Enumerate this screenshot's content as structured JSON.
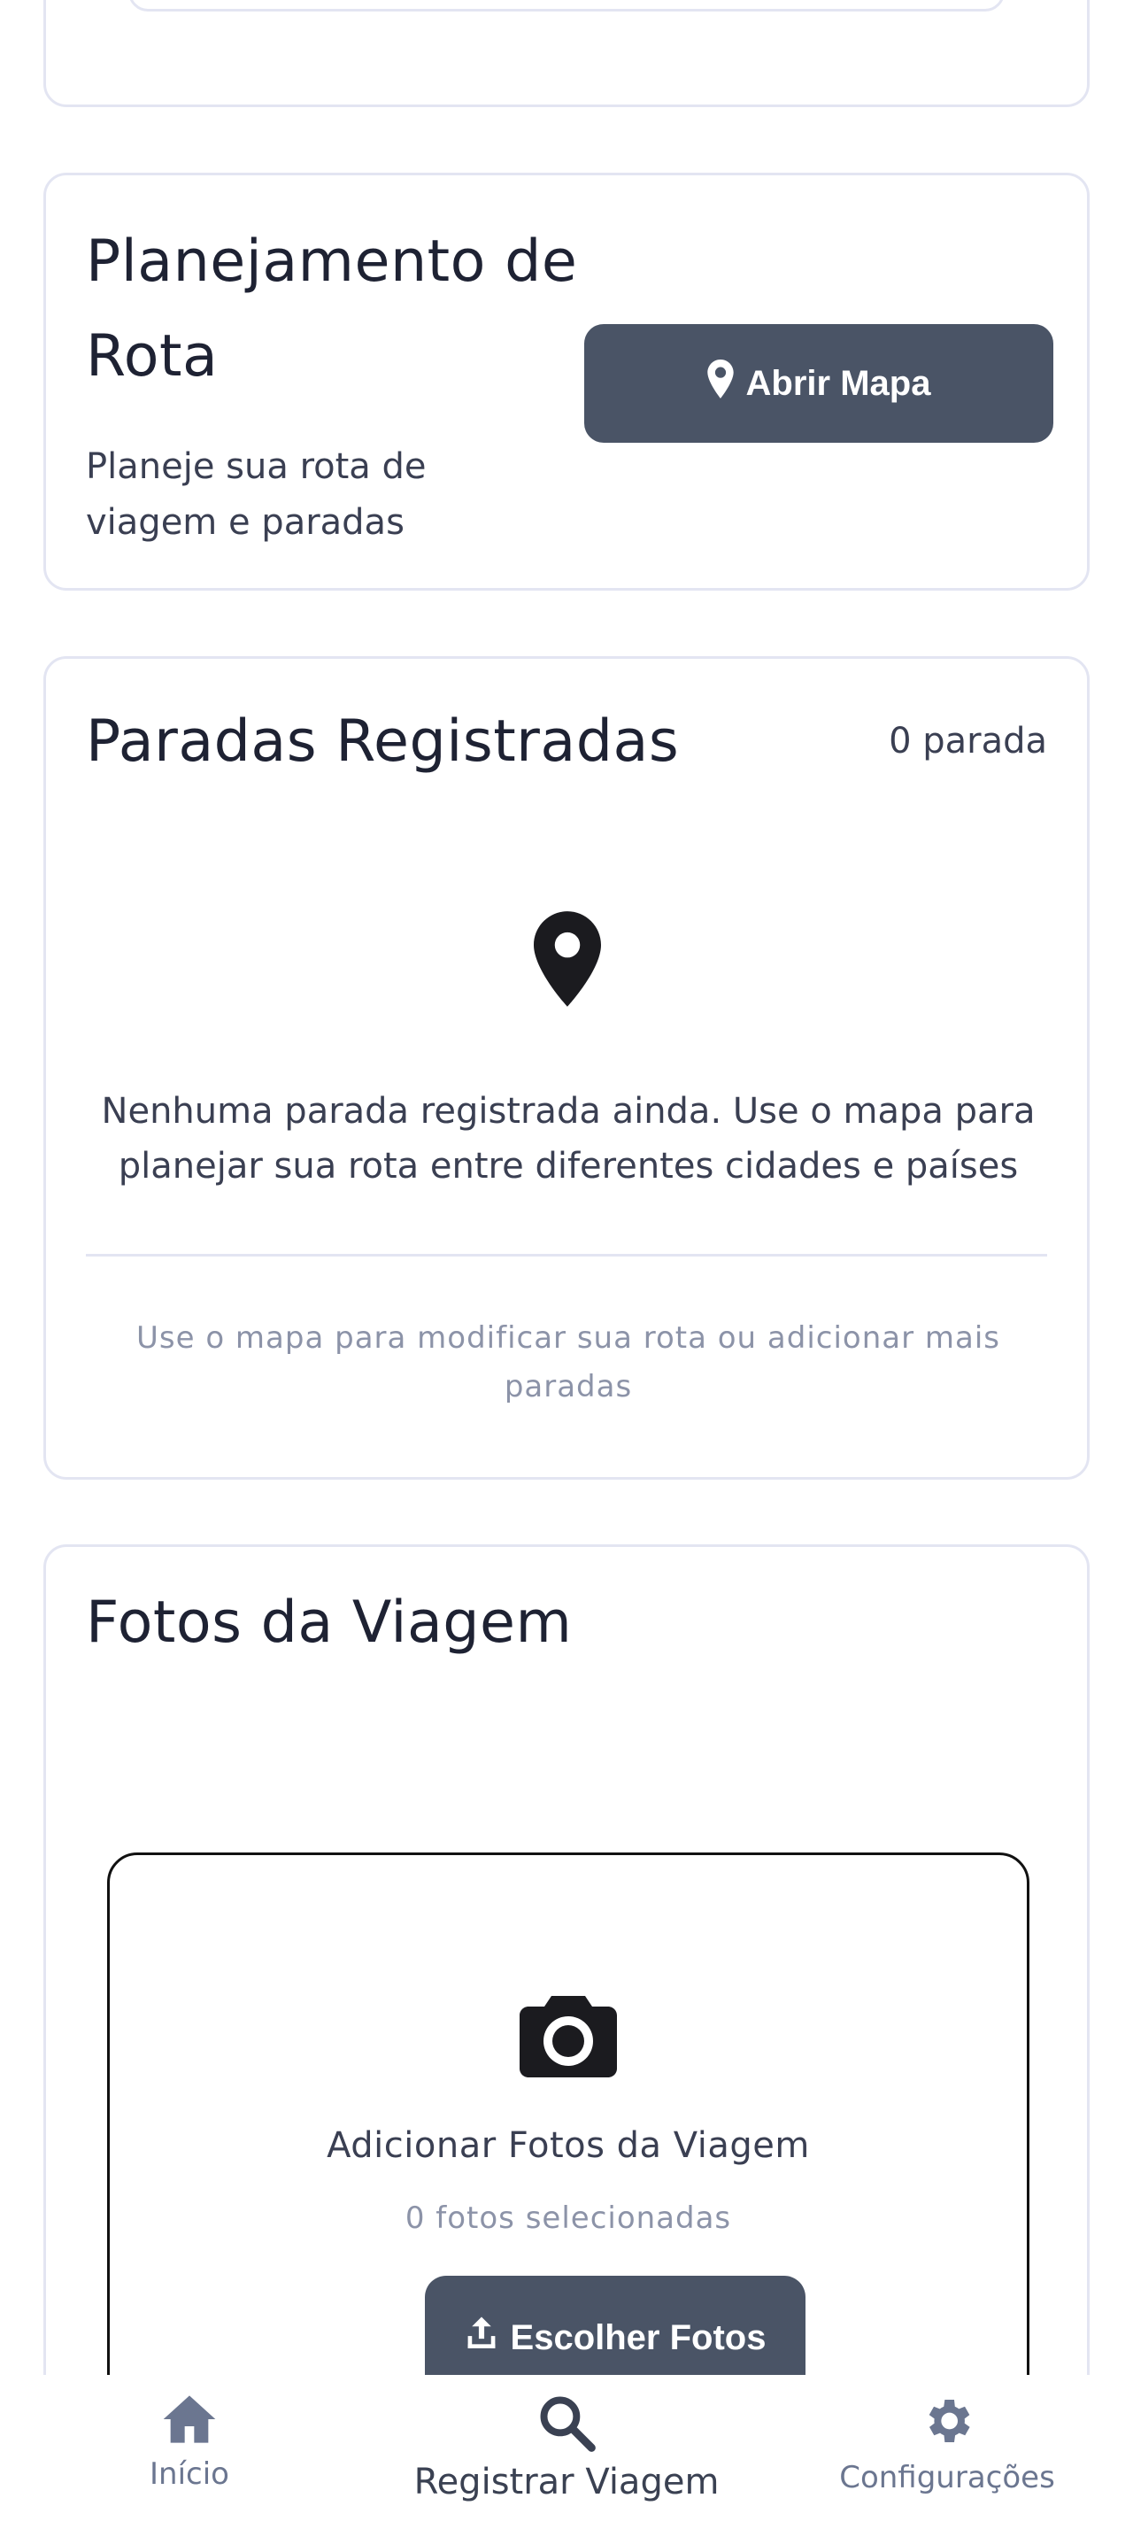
{
  "route_card": {
    "title": "Planejamento de Rota",
    "description": "Planeje sua rota de viagem e paradas",
    "map_button": "Abrir Mapa"
  },
  "stops_card": {
    "title": "Paradas Registradas",
    "count": "0 parada",
    "empty_message": "Nenhuma parada registrada ainda. Use o mapa para planejar sua rota entre diferentes cidades e países",
    "hint": "Use o mapa para modificar sua rota ou adicionar mais paradas"
  },
  "photos_card": {
    "title": "Fotos da Viagem",
    "upload_label": "Adicionar Fotos da Viagem",
    "selected_count": "0 fotos selecionadas",
    "choose_button": "Escolher Fotos"
  },
  "bottom_nav": {
    "home": "Início",
    "register": "Registrar Viagem",
    "settings": "Configurações"
  },
  "colors": {
    "button_bg": "#4a5466",
    "border": "#e3e5f2",
    "muted_text": "#8c93a8"
  },
  "icons": {
    "map_button": "map-marker-icon",
    "empty_stops": "map-marker-icon",
    "upload": "camera-icon",
    "choose_button": "upload-icon",
    "nav_home": "home-icon",
    "nav_register": "search-icon",
    "nav_settings": "gear-icon"
  }
}
